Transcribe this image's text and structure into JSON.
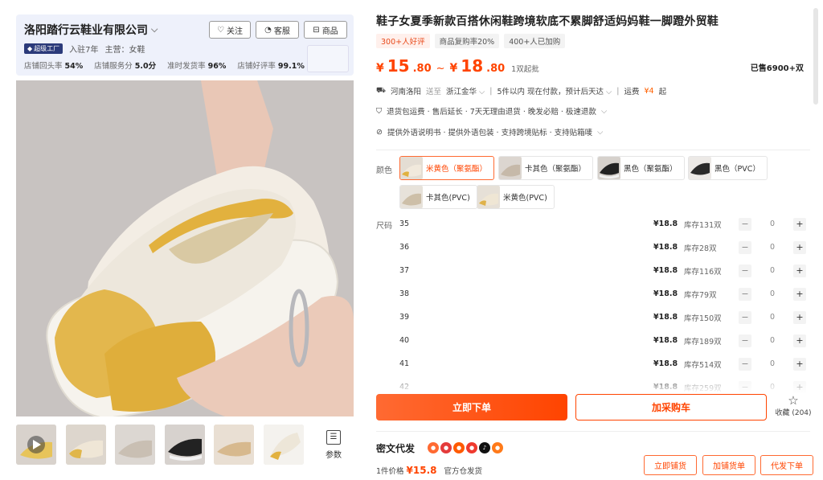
{
  "shop": {
    "name": "洛阳踏行云鞋业有限公司",
    "follow": "关注",
    "service": "客服",
    "products": "商品",
    "factory_badge": "超级工厂",
    "years": "入驻7年",
    "main_business": "主营：女鞋",
    "stats": [
      {
        "label": "店铺回头率",
        "value": "54%"
      },
      {
        "label": "店铺服务分",
        "value": "5.0分"
      },
      {
        "label": "准时发货率",
        "value": "96%"
      },
      {
        "label": "店铺好评率",
        "value": "99.1%"
      }
    ]
  },
  "gallery": {
    "params_label": "参数",
    "thumb_count": 6
  },
  "product": {
    "title": "鞋子女夏季新款百搭休闲鞋跨境软底不累脚舒适妈妈鞋一脚蹬外贸鞋",
    "tags": [
      "300+人好评",
      "商品复购率20%",
      "400+人已加购"
    ],
    "price": {
      "currency": "¥",
      "low_int": "15",
      "low_dec": ".80",
      "sep": "~",
      "high_int": "18",
      "high_dec": ".80",
      "moq": "1双起批"
    },
    "sold": "已售6900+双",
    "shipping": {
      "from": "河南洛阳",
      "to_word": "送至",
      "to": "浙江金华",
      "delivery": "5件以内  现在付款，预计后天达",
      "fee_label": "运费",
      "fee": "¥4",
      "fee_suffix": "起"
    },
    "guarantees": "退货包运费 · 售后延长 · 7天无理由退货 · 晚发必赔 · 极速退款",
    "services": "提供外语说明书 · 提供外语包装 · 支持跨境贴标 · 支持贴箱唛"
  },
  "colors": {
    "label": "颜色",
    "options": [
      {
        "name": "米黄色（聚氨酯）",
        "selected": true
      },
      {
        "name": "卡其色（聚氨酯）",
        "selected": false
      },
      {
        "name": "黑色（聚氨酯）",
        "selected": false
      },
      {
        "name": "黑色（PVC）",
        "selected": false
      },
      {
        "name": "卡其色(PVC)",
        "selected": false
      },
      {
        "name": "米黄色(PVC)",
        "selected": false
      }
    ]
  },
  "sizes": {
    "label": "尺码",
    "rows": [
      {
        "size": "35",
        "price": "¥18.8",
        "stock": "库存131双",
        "qty": "0"
      },
      {
        "size": "36",
        "price": "¥18.8",
        "stock": "库存28双",
        "qty": "0"
      },
      {
        "size": "37",
        "price": "¥18.8",
        "stock": "库存116双",
        "qty": "0"
      },
      {
        "size": "38",
        "price": "¥18.8",
        "stock": "库存79双",
        "qty": "0"
      },
      {
        "size": "39",
        "price": "¥18.8",
        "stock": "库存150双",
        "qty": "0"
      },
      {
        "size": "40",
        "price": "¥18.8",
        "stock": "库存189双",
        "qty": "0"
      },
      {
        "size": "41",
        "price": "¥18.8",
        "stock": "库存514双",
        "qty": "0"
      },
      {
        "size": "42",
        "price": "¥18.8",
        "stock": "库存259双",
        "qty": "0"
      }
    ]
  },
  "actions": {
    "order": "立即下单",
    "cart": "加采购车",
    "favorite": "收藏 (204)"
  },
  "proxy": {
    "title": "密文代发",
    "price_prefix": "1件价格",
    "price": "¥15.8",
    "warehouse": "官方仓发货",
    "buttons": [
      "立即铺货",
      "加铺货单",
      "代发下单"
    ]
  },
  "colors_theme": {
    "accent": "#ff4400",
    "shop_bg": "#eef1fb"
  }
}
